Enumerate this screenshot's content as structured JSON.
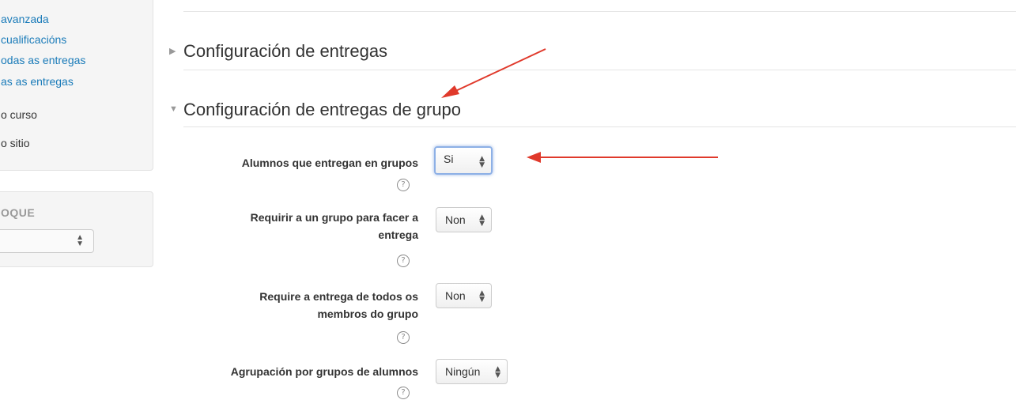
{
  "sidebar": {
    "links": [
      "avanzada",
      "cualificacións",
      "odas as entregas",
      "as as entregas"
    ],
    "items": [
      "o curso",
      "o sitio"
    ],
    "add_block_heading": "OQUE"
  },
  "sections": {
    "submission_settings": {
      "title": "Configuración de entregas",
      "state": "collapsed"
    },
    "group_submission_settings": {
      "title": "Configuración de entregas de grupo",
      "state": "expanded"
    }
  },
  "fields": [
    {
      "label": "Alumnos que entregan en grupos",
      "value": "Si"
    },
    {
      "label": "Requirir a un grupo para facer a entrega",
      "value": "Non"
    },
    {
      "label": "Require a entrega de todos os membros do grupo",
      "value": "Non"
    },
    {
      "label": "Agrupación por grupos de alumnos",
      "value": "Ningún"
    }
  ],
  "help_icon": "question-circle-icon",
  "annotation_color": "#e0392b",
  "link_color": "#1a7bb9"
}
